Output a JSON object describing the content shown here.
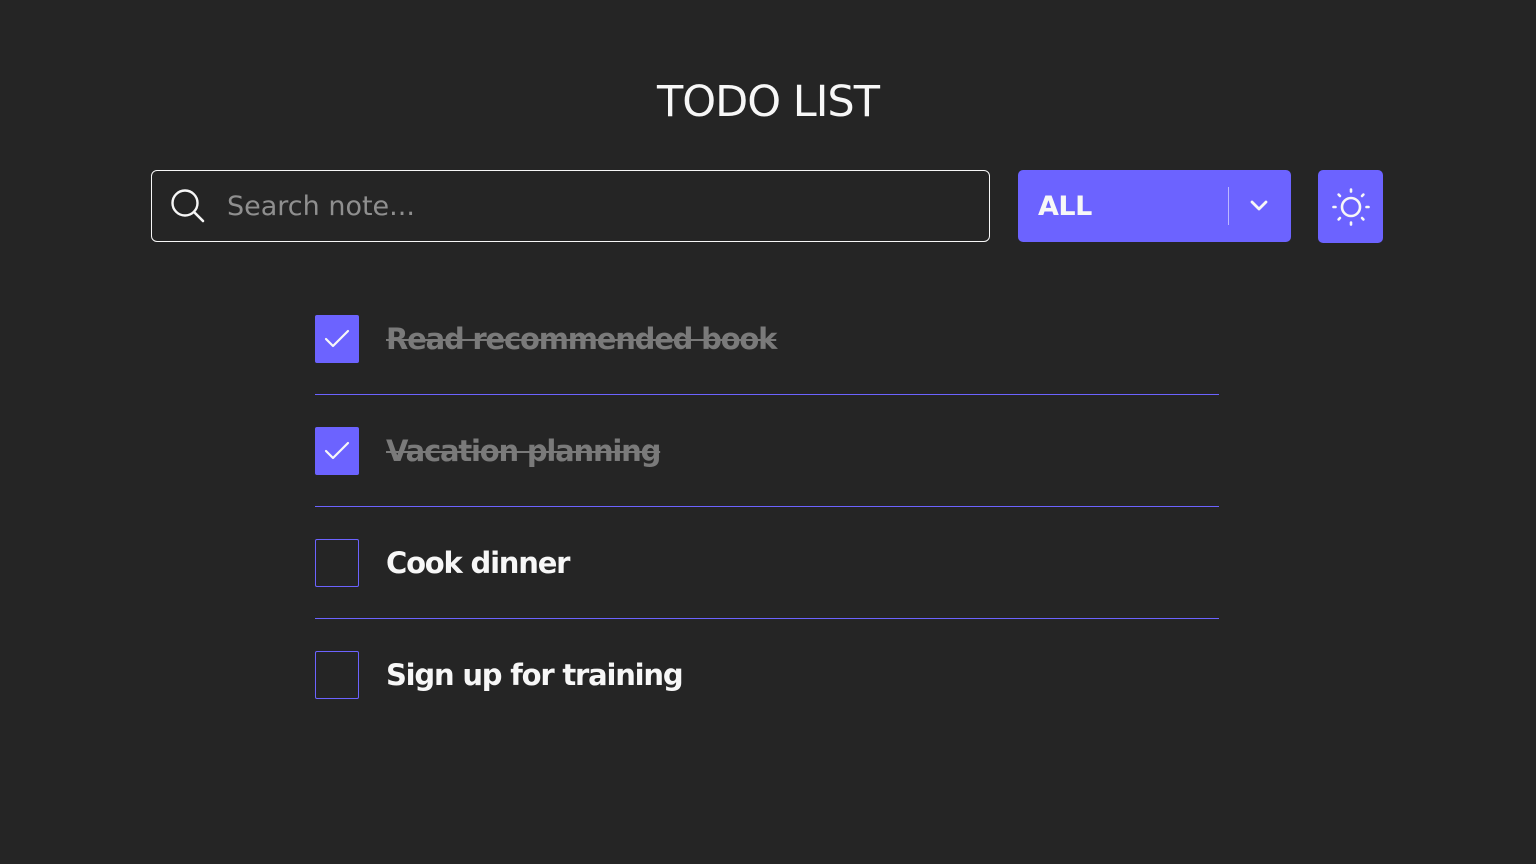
{
  "app": {
    "title": "TODO LIST"
  },
  "search": {
    "placeholder": "Search note...",
    "value": ""
  },
  "filter": {
    "selected": "ALL"
  },
  "theme_toggle": {
    "icon": "sun-icon"
  },
  "todos": [
    {
      "text": "Read recommended book",
      "done": true
    },
    {
      "text": "Vacation planning",
      "done": true
    },
    {
      "text": "Cook dinner",
      "done": false
    },
    {
      "text": "Sign up for training",
      "done": false
    }
  ],
  "colors": {
    "background": "#252525",
    "accent": "#6c63ff",
    "text": "#f7f7f7",
    "done_text": "#7a7a7a",
    "placeholder": "#8f8f8f"
  }
}
